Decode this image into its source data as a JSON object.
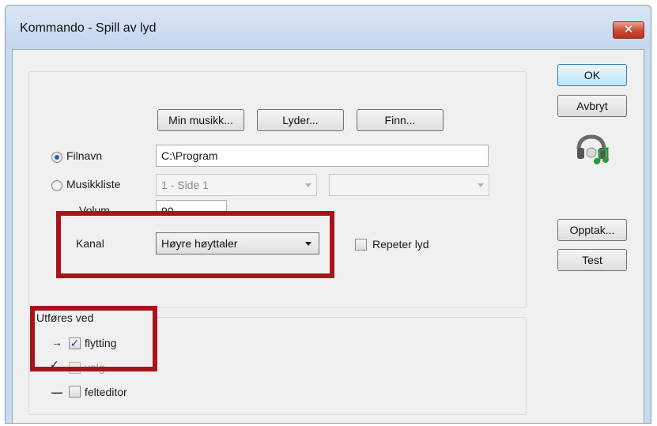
{
  "window": {
    "title": "Kommando - Spill av lyd",
    "close_glyph": "✕"
  },
  "buttons": {
    "ok": "OK",
    "cancel": "Avbryt",
    "record": "Opptak...",
    "test": "Test",
    "my_music": "Min musikk...",
    "sounds": "Lyder...",
    "find": "Finn..."
  },
  "source": {
    "filename_label": "Filnavn",
    "filename_value": "C:\\Program",
    "filename_checked": true,
    "playlist_label": "Musikkliste",
    "playlist_value": "1 - Side 1",
    "playlist_second_value": ""
  },
  "volume": {
    "label": "Volum",
    "value": "90"
  },
  "channel": {
    "label": "Kanal",
    "value": "Høyre høyttaler"
  },
  "repeat": {
    "label": "Repeter lyd",
    "checked": false
  },
  "trigger": {
    "heading": "Utføres ved",
    "items": [
      {
        "symbol": "→",
        "label": "flytting",
        "checked": true,
        "enabled": true
      },
      {
        "symbol": "✓",
        "label": "valg",
        "checked": false,
        "enabled": false
      },
      {
        "symbol": "—",
        "label": "felteditor",
        "checked": false,
        "enabled": true
      }
    ]
  },
  "icons": {
    "sound": "speaker-music-icon"
  },
  "colors": {
    "highlight": "#a8141a",
    "title_bg": "#c8daf0",
    "close_red": "#c84a35"
  }
}
